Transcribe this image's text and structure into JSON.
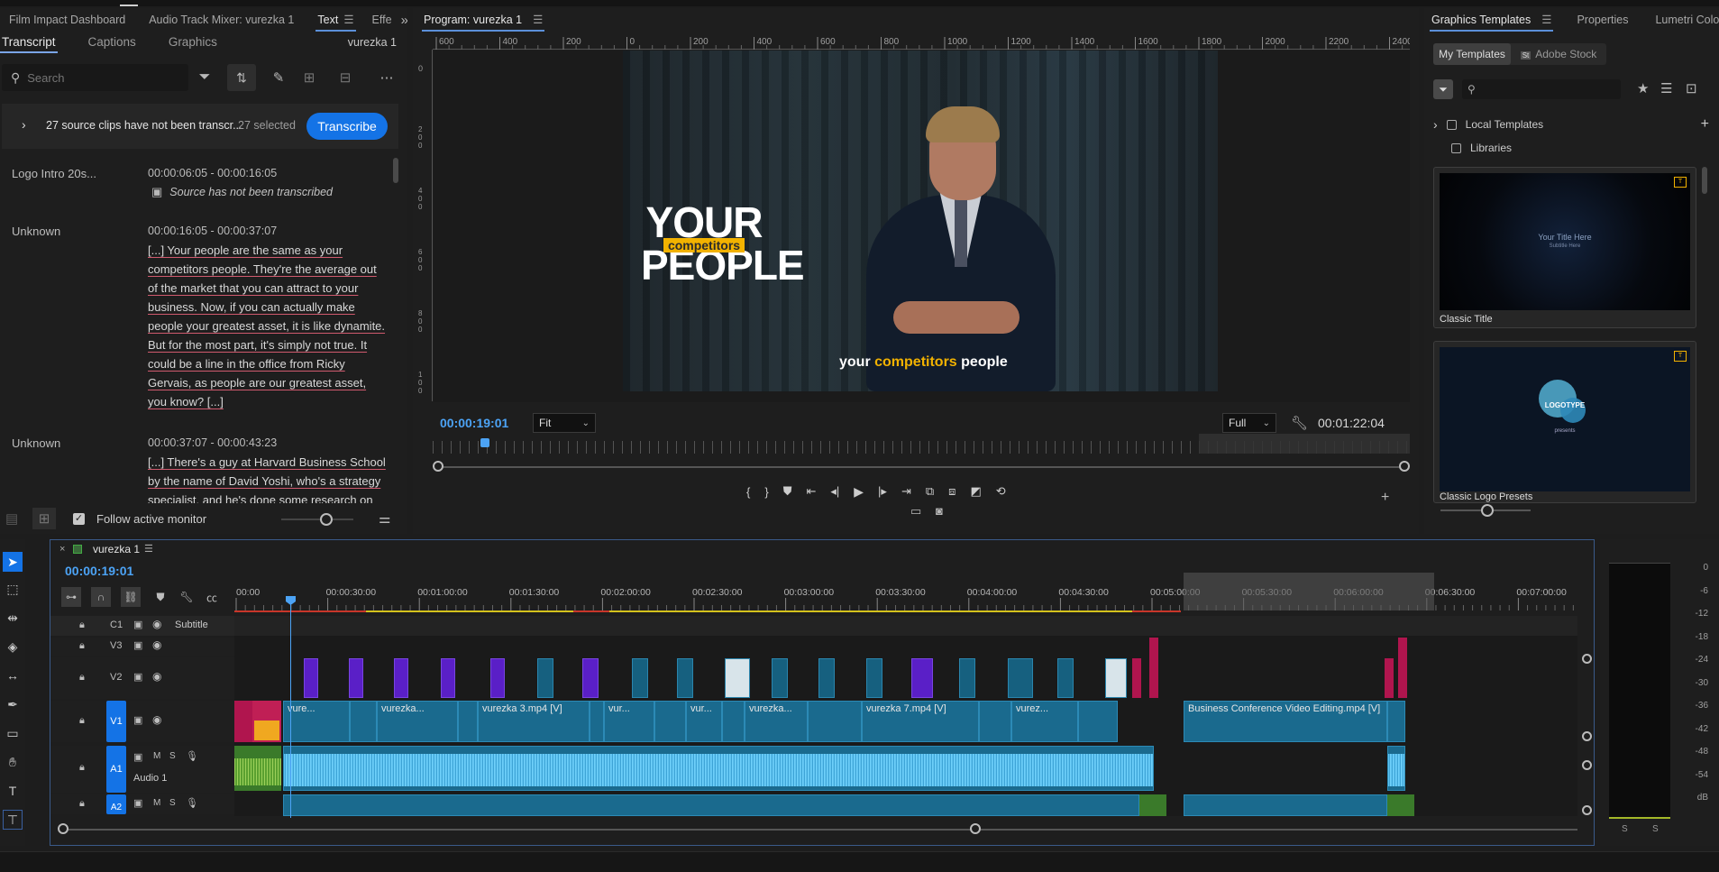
{
  "left_panel": {
    "tabs": [
      "Film Impact Dashboard",
      "Audio Track Mixer: vurezka 1",
      "Text",
      "Effe"
    ],
    "subtabs": [
      "Transcript",
      "Captions",
      "Graphics"
    ],
    "sequence_name": "vurezka 1",
    "search_placeholder": "Search",
    "banner_text": "27 source clips have not been transcr...",
    "banner_selected": "27 selected",
    "transcribe_label": "Transcribe",
    "entries": [
      {
        "speaker": "Logo Intro 20s...",
        "timecode": "00:00:06:05 - 00:00:16:05",
        "note": "Source has not been transcribed"
      },
      {
        "speaker": "Unknown",
        "timecode": "00:00:16:05 - 00:00:37:07",
        "text": "[...] Your people are the same as your competitors people. They're the average out of the market that you can attract to your business. Now, if you can actually make people your greatest asset, it is like dynamite. But for the most part, it's simply not true. It could be a line in the office from Ricky Gervais, as people are our greatest asset, you know? [...]"
      },
      {
        "speaker": "Unknown",
        "timecode": "00:00:37:07 - 00:00:43:23",
        "text": "[...] There's a guy at Harvard Business School by the name of David Yoshi, who's a strategy specialist, and he's done some research on"
      }
    ],
    "follow_label": "Follow active monitor"
  },
  "program": {
    "title": "Program: vurezka 1",
    "ruler_ticks": [
      "600",
      "400",
      "200",
      "0",
      "200",
      "400",
      "600",
      "800",
      "1000",
      "1200",
      "1400",
      "1600",
      "1800",
      "2000",
      "2200",
      "2400"
    ],
    "vruler_ticks": [
      "0",
      "2 0 0",
      "4 0 0",
      "6 0 0",
      "8 0 0",
      "1 0 0"
    ],
    "overlay_big1": "YOUR",
    "overlay_tag": "competitors",
    "overlay_big2": "PEOPLE",
    "subtitle_pre": "your ",
    "subtitle_hl": "competitors",
    "subtitle_post": " people",
    "timecode": "00:00:19:01",
    "fit": "Fit",
    "quality": "Full",
    "duration": "00:01:22:04"
  },
  "templates": {
    "tabs": [
      "Graphics Templates",
      "Properties",
      "Lumetri Color"
    ],
    "subtabs": [
      "My Templates",
      "Adobe Stock"
    ],
    "tree": [
      "Local Templates",
      "Libraries"
    ],
    "cards": [
      {
        "title": "Classic Title",
        "preview_line1": "Your Title Here",
        "preview_line2": "Subtitle Here"
      },
      {
        "title": "Classic Logo Presets",
        "preview_line1": "LOGOTYPE",
        "preview_line2": "presents"
      }
    ]
  },
  "timeline": {
    "sequence": "vurezka 1",
    "timecode": "00:00:19:01",
    "ruler": [
      "00:00",
      "00:00:30:00",
      "00:01:00:00",
      "00:01:30:00",
      "00:02:00:00",
      "00:02:30:00",
      "00:03:00:00",
      "00:03:30:00",
      "00:04:00:00",
      "00:04:30:00",
      "00:05:00:00",
      "00:05:30:00",
      "00:06:00:00",
      "00:06:30:00",
      "00:07:00:00"
    ],
    "tracks": {
      "c1": "C1",
      "c1_name": "Subtitle",
      "v3": "V3",
      "v2": "V2",
      "v1": "V1",
      "a1": "A1",
      "a1_name": "Audio 1",
      "a2": "A2"
    },
    "clips": [
      "vure...",
      "vurezka...",
      "vurezka 3.mp4 [V]",
      "vur...",
      "vur...",
      "vurezka...",
      "vurezka 7.mp4 [V]",
      "vurez...",
      "Business Conference Video Editing.mp4 [V]"
    ]
  },
  "meter": {
    "labels": [
      "0",
      "-6",
      "-12",
      "-18",
      "-24",
      "-30",
      "-36",
      "-42",
      "-48",
      "-54",
      "dB"
    ],
    "solo": [
      "S",
      "S"
    ]
  }
}
